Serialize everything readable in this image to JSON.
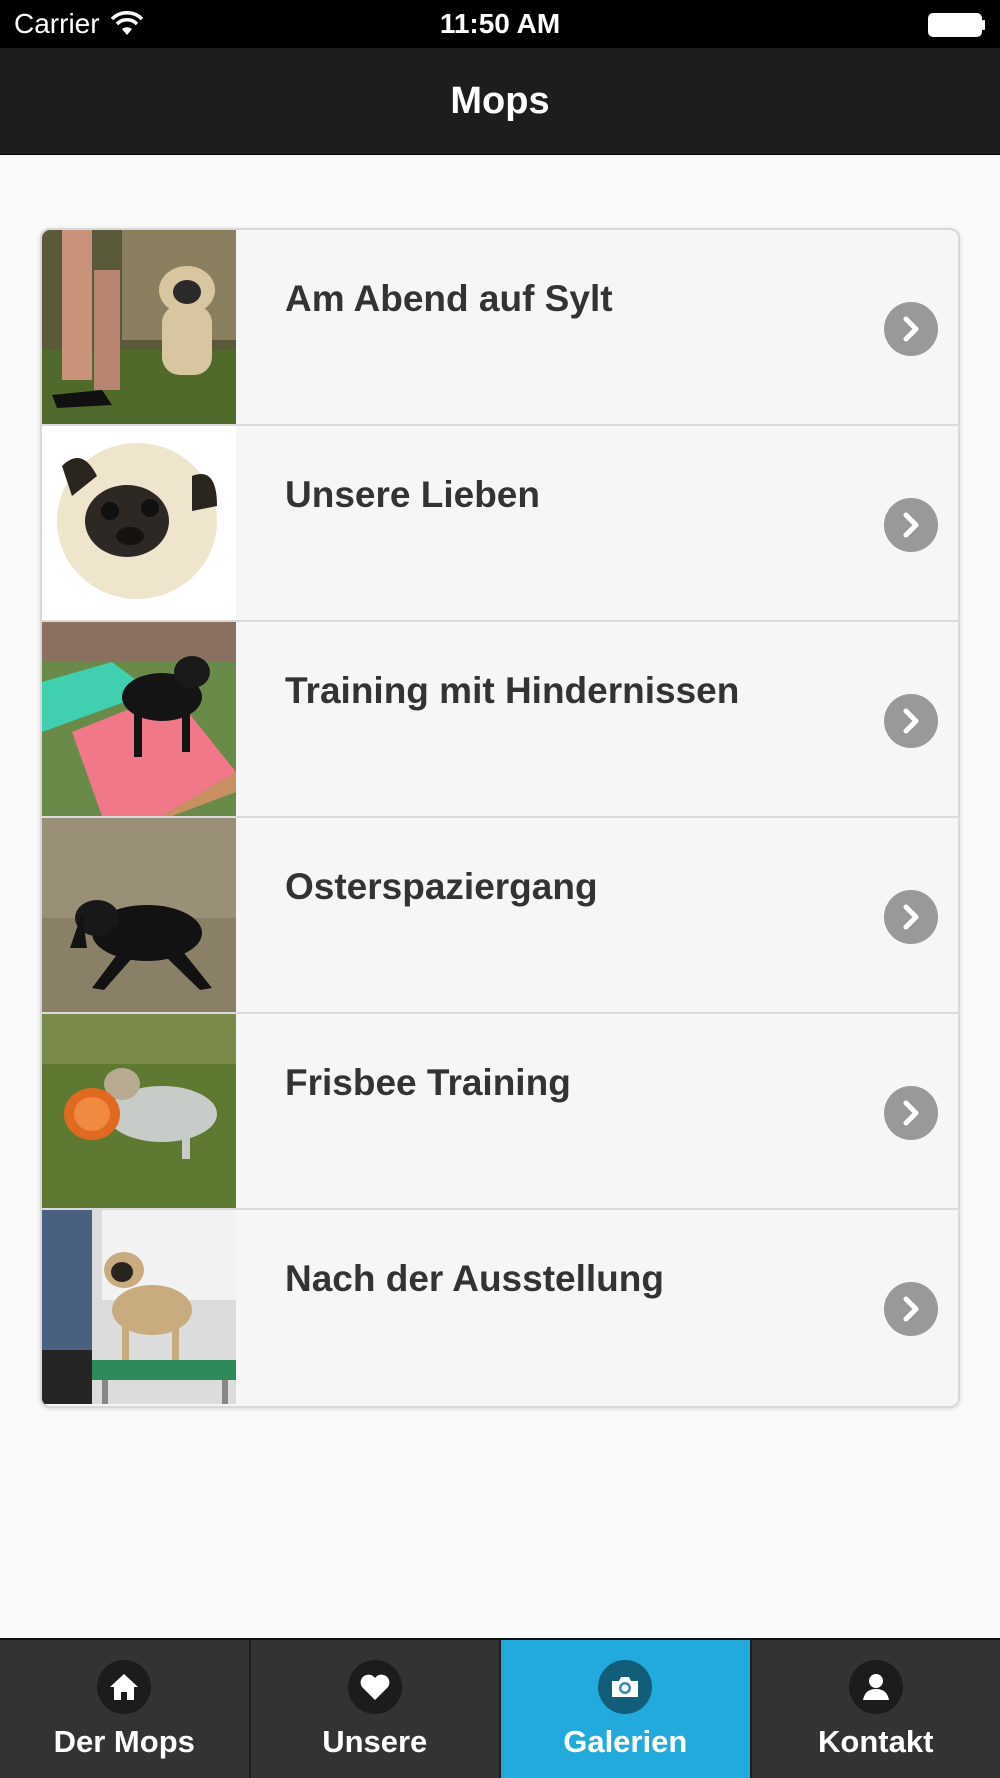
{
  "status_bar": {
    "carrier": "Carrier",
    "time": "11:50 AM"
  },
  "header": {
    "title": "Mops"
  },
  "gallery": {
    "items": [
      {
        "label": "Am Abend auf Sylt",
        "thumb_icon": "pug-on-leash-photo"
      },
      {
        "label": "Unsere Lieben",
        "thumb_icon": "pug-face-photo"
      },
      {
        "label": "Training mit Hindernissen",
        "thumb_icon": "black-pug-on-ramp-photo"
      },
      {
        "label": "Osterspaziergang",
        "thumb_icon": "black-pug-running-photo"
      },
      {
        "label": "Frisbee Training",
        "thumb_icon": "pug-with-frisbee-photo"
      },
      {
        "label": "Nach der Ausstellung",
        "thumb_icon": "pug-on-show-table-photo"
      }
    ]
  },
  "tab_bar": {
    "active_color": "#22aadd",
    "tabs": [
      {
        "label": "Der Mops",
        "icon": "home-icon",
        "active": false
      },
      {
        "label": "Unsere",
        "icon": "heart-icon",
        "active": false
      },
      {
        "label": "Galerien",
        "icon": "camera-icon",
        "active": true
      },
      {
        "label": "Kontakt",
        "icon": "person-icon",
        "active": false
      }
    ]
  }
}
